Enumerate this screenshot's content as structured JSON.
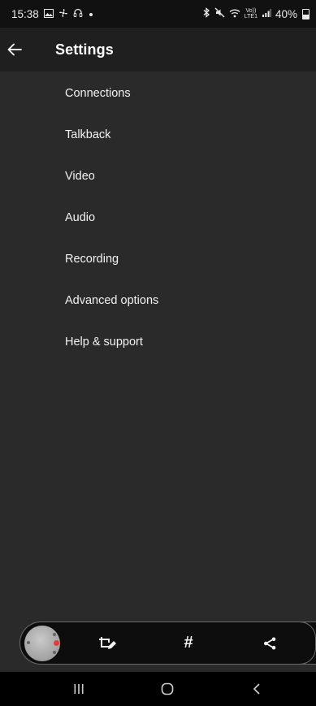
{
  "status_bar": {
    "time": "15:38",
    "left_icons": [
      "gallery-icon",
      "fan-icon",
      "headset-icon",
      "dot-icon"
    ],
    "right_icons": [
      "bluetooth-icon",
      "mute-icon",
      "wifi-icon",
      "volte-icon",
      "signal-icon",
      "battery-icon"
    ],
    "volte_top": "Vo))",
    "volte_bottom": "LTE1",
    "battery_percent": "40%"
  },
  "app_bar": {
    "back_icon": "arrow-left-icon",
    "title": "Settings"
  },
  "settings": {
    "items": [
      {
        "label": "Connections"
      },
      {
        "label": "Talkback"
      },
      {
        "label": "Video"
      },
      {
        "label": "Audio"
      },
      {
        "label": "Recording"
      },
      {
        "label": "Advanced options"
      },
      {
        "label": "Help & support"
      }
    ]
  },
  "toolbar": {
    "camera_icon": "camera-knob-icon",
    "crop_edit_icon": "crop-edit-icon",
    "hash_label": "#",
    "share_icon": "share-icon"
  },
  "nav_bar": {
    "recents_icon": "recents-icon",
    "home_icon": "home-icon",
    "back_icon": "back-chevron-icon"
  },
  "colors": {
    "background": "#2a2a2a",
    "app_bar": "#1f1f1f",
    "status_bar": "#111111",
    "toolbar": "#0d0d0d",
    "text": "#ffffff",
    "record_dot": "#e23b3b"
  }
}
